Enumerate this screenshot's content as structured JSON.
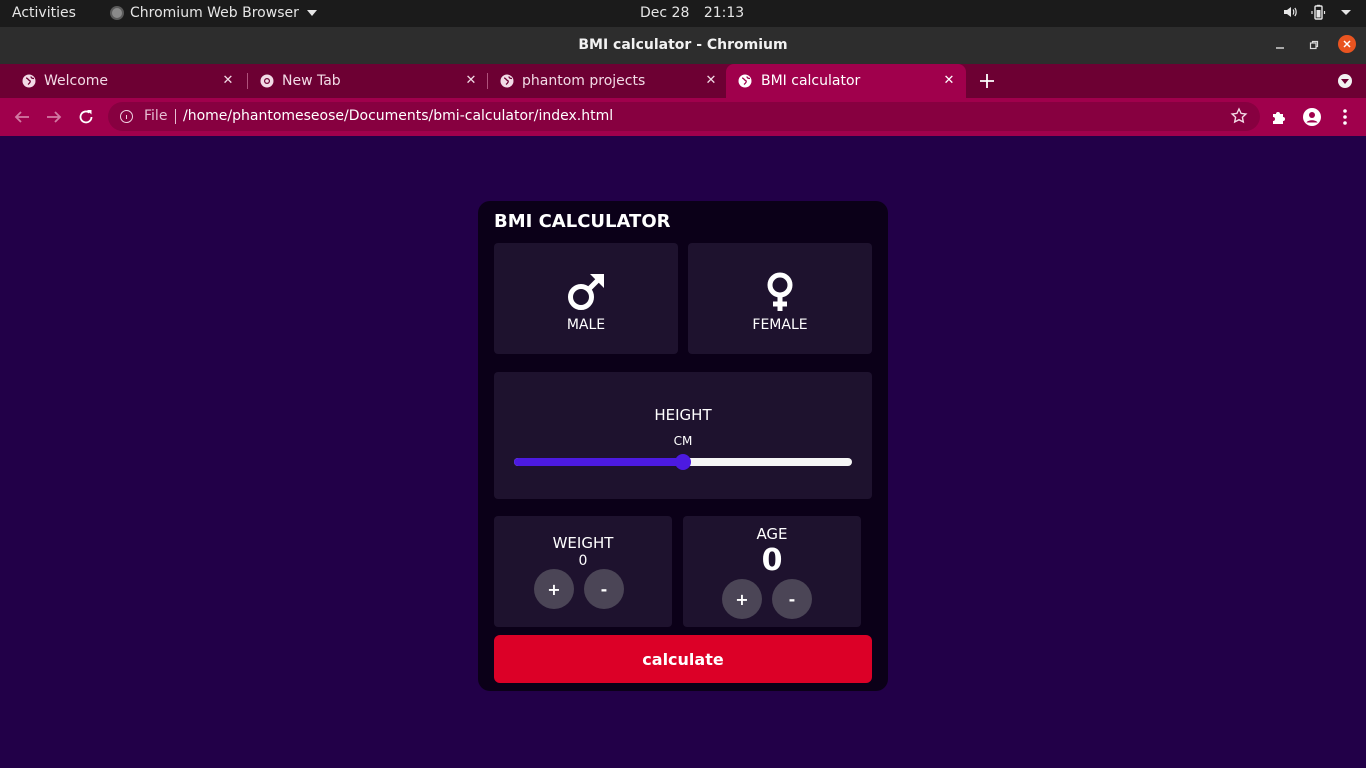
{
  "system_bar": {
    "activities": "Activities",
    "app_name": "Chromium Web Browser",
    "date": "Dec 28",
    "time": "21:13"
  },
  "window": {
    "title": "BMI calculator - Chromium"
  },
  "tabs": [
    {
      "label": "Welcome",
      "active": false,
      "icon": "globe-icon"
    },
    {
      "label": "New Tab",
      "active": false,
      "icon": "chromium-icon"
    },
    {
      "label": "phantom projects",
      "active": false,
      "icon": "globe-icon"
    },
    {
      "label": "BMI calculator",
      "active": true,
      "icon": "globe-icon"
    }
  ],
  "omnibox": {
    "scheme": "File",
    "url": "/home/phantomeseose/Documents/bmi-calculator/index.html"
  },
  "app": {
    "title": "BMI CALCULATOR",
    "gender": {
      "male": "MALE",
      "female": "FEMALE"
    },
    "height": {
      "label": "HEIGHT",
      "unit": "CM",
      "slider_fraction": 0.5
    },
    "weight": {
      "label": "WEIGHT",
      "value": "0",
      "plus": "+",
      "minus": "-"
    },
    "age": {
      "label": "AGE",
      "value": "0",
      "plus": "+",
      "minus": "-"
    },
    "calculate": "calculate"
  },
  "colors": {
    "page_bg": "#220048",
    "card_bg": "#0b0018",
    "panel_bg": "#1e122e",
    "slider_accent": "#4c1ae0",
    "calculate_button": "#dc0027",
    "tab_strip": "#6d0033",
    "toolbar": "#a0004c"
  }
}
